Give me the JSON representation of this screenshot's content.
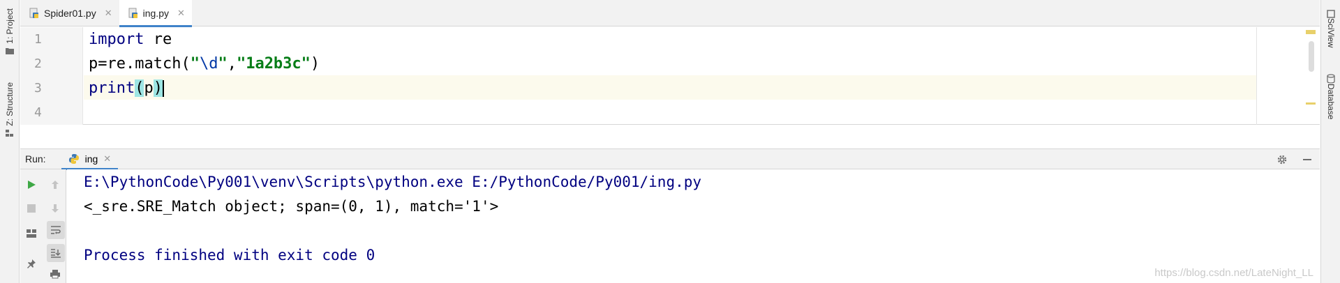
{
  "tool_windows": {
    "left": [
      "1: Project",
      "Z: Structure"
    ],
    "right": [
      "SciView",
      "Database"
    ]
  },
  "editor_tabs": [
    {
      "label": "Spider01.py",
      "active": false
    },
    {
      "label": "ing.py",
      "active": true
    }
  ],
  "editor": {
    "line_numbers": [
      "1",
      "2",
      "3",
      "4"
    ],
    "lines": [
      {
        "kw": "import",
        "rest": " re"
      },
      {
        "a": "p=re.match(",
        "s1a": "\"",
        "s1esc": "\\d",
        "s1b": "\"",
        "comma": ",",
        "s2": "\"1a2b3c\"",
        "close": ")"
      },
      {
        "fn": "print",
        "open": "(",
        "arg": "p",
        "close": ")"
      }
    ]
  },
  "run_panel": {
    "label": "Run:",
    "tab_label": "ing",
    "console": [
      "E:\\PythonCode\\Py001\\venv\\Scripts\\python.exe E:/PythonCode/Py001/ing.py",
      "<_sre.SRE_Match object; span=(0, 1), match='1'>",
      "",
      "Process finished with exit code 0"
    ]
  },
  "watermark": "https://blog.csdn.net/LateNight_LL",
  "icons": {
    "python_file": "python-file-icon",
    "run": "run-icon",
    "stop": "stop-icon",
    "gear": "gear-icon",
    "minimize": "minimize-icon"
  },
  "colors": {
    "accent": "#4083c9",
    "keyword": "#000080",
    "string": "#067d17",
    "run_green": "#3fa846",
    "caret_row": "#fcfaed"
  }
}
